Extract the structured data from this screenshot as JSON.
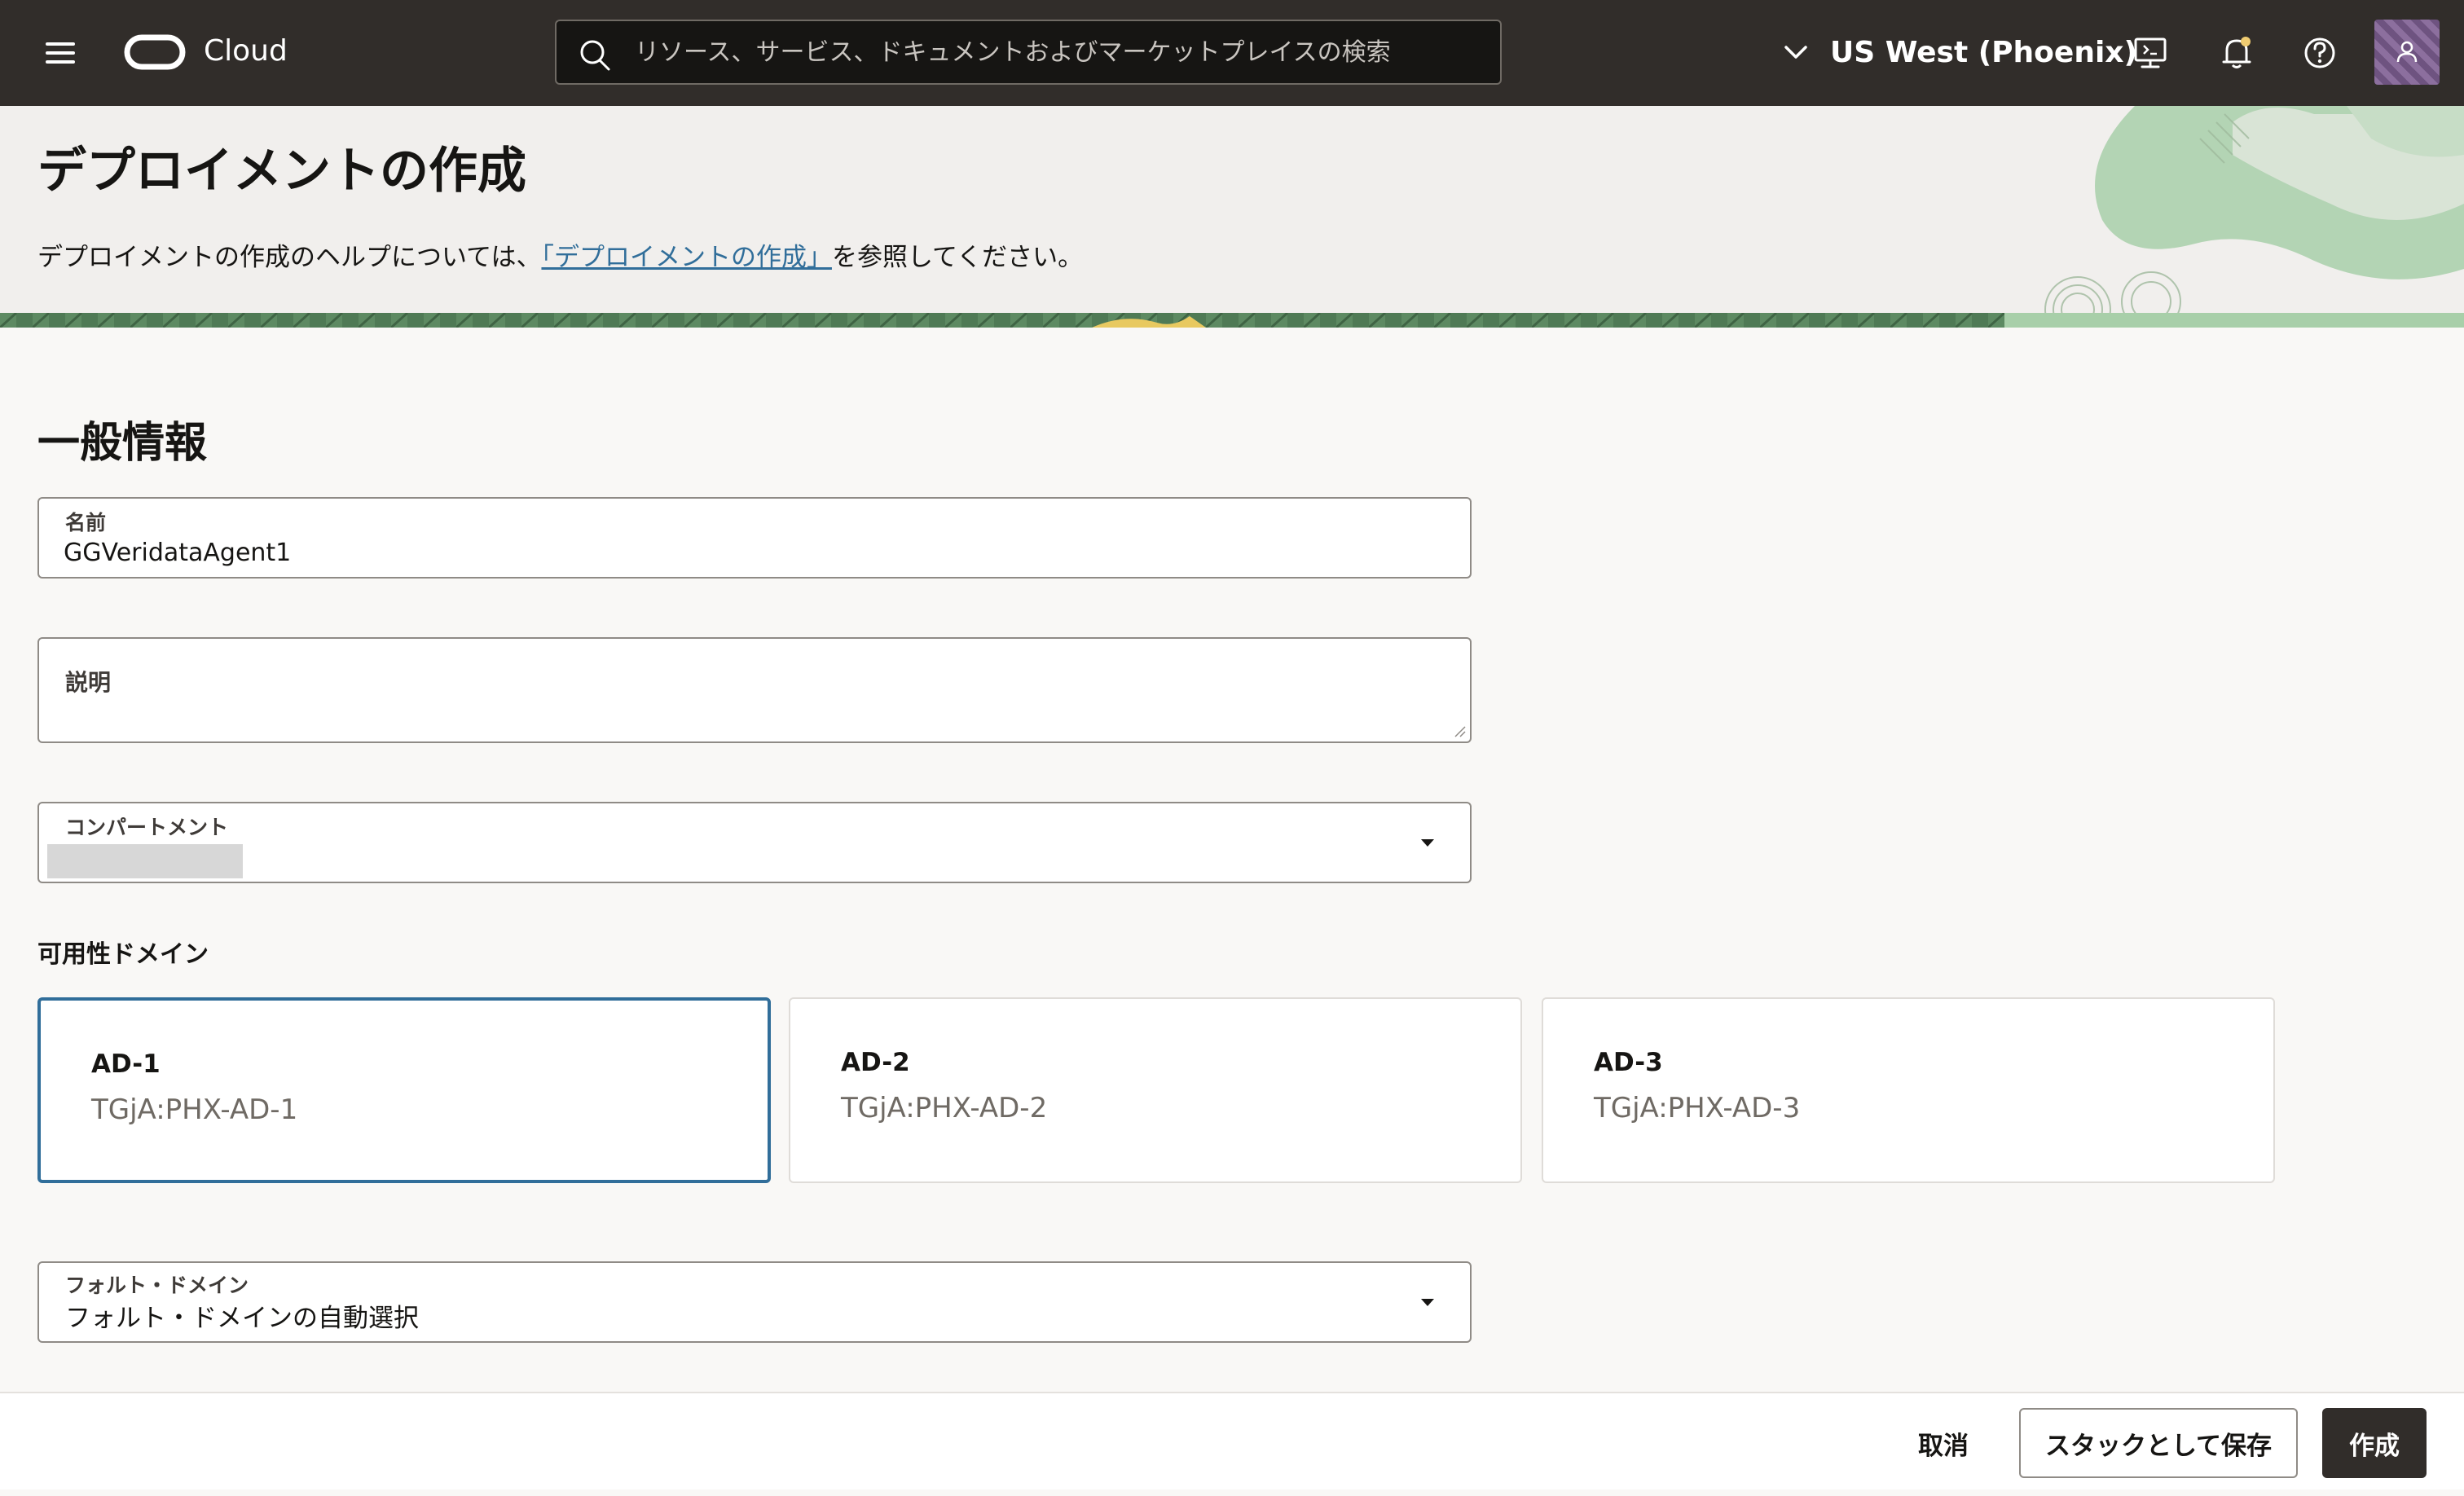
{
  "header": {
    "brand": "Cloud",
    "search_placeholder": "リソース、サービス、ドキュメントおよびマーケットプレイスの検索",
    "region": "US West (Phoenix)"
  },
  "page": {
    "title": "デプロイメントの作成",
    "help_prefix": "デプロイメントの作成のヘルプについては、",
    "help_link": "「デプロイメントの作成」",
    "help_suffix": "を参照してください。"
  },
  "form": {
    "section_title": "一般情報",
    "name": {
      "label": "名前",
      "value": "GGVeridataAgent1"
    },
    "description": {
      "label": "説明",
      "value": ""
    },
    "compartment": {
      "label": "コンパートメント"
    },
    "availability_domain": {
      "label": "可用性ドメイン",
      "options": [
        {
          "name": "AD-1",
          "id": "TGjA:PHX-AD-1",
          "selected": true
        },
        {
          "name": "AD-2",
          "id": "TGjA:PHX-AD-2",
          "selected": false
        },
        {
          "name": "AD-3",
          "id": "TGjA:PHX-AD-3",
          "selected": false
        }
      ]
    },
    "fault_domain": {
      "label": "フォルト・ドメイン",
      "value": "フォルト・ドメインの自動選択"
    }
  },
  "footer": {
    "cancel": "取消",
    "save_stack": "スタックとして保存",
    "create": "作成"
  },
  "colors": {
    "topbar": "#312d2a",
    "accent": "#316e9a",
    "primary_button": "#312d2a"
  }
}
